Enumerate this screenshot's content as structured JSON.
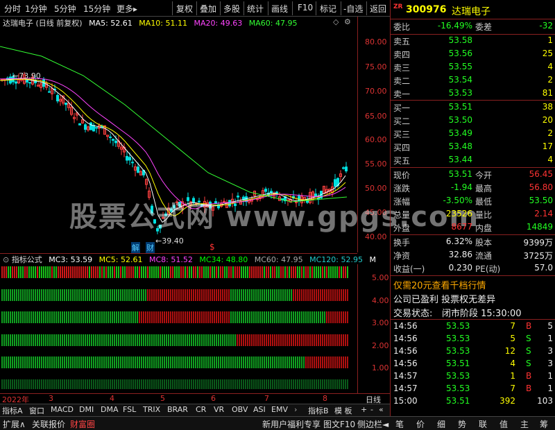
{
  "toolbar": {
    "items": [
      "分时",
      "1分钟",
      "5分钟",
      "15分钟",
      "更多",
      "复权",
      "叠加",
      "多股",
      "统计",
      "画线",
      "F10",
      "标记",
      "-自选",
      "返回"
    ]
  },
  "chart": {
    "title": "达瑞电子 (日线 前复权)",
    "ma": [
      {
        "label": "MA5: 52.61",
        "color": "#ffffff"
      },
      {
        "label": "MA10: 51.11",
        "color": "#ffff00"
      },
      {
        "label": "MA20: 49.63",
        "color": "#ff44ff"
      },
      {
        "label": "MA60: 47.95",
        "color": "#33ff33"
      }
    ],
    "y_ticks": [
      "80.00",
      "75.00",
      "70.00",
      "65.00",
      "60.00",
      "55.00",
      "50.00",
      "45.00",
      "40.00"
    ],
    "high_annot": "73.90",
    "low_annot": "39.40",
    "jie": "解",
    "cai": "财",
    "dollar": "$"
  },
  "indicator": {
    "title": "指标公式",
    "labels": [
      {
        "t": "MC3: 53.59",
        "c": "#ffffff"
      },
      {
        "t": "MC5: 52.61",
        "c": "#ffff00"
      },
      {
        "t": "MC8: 51.52",
        "c": "#ff44ff"
      },
      {
        "t": "MC34: 48.80",
        "c": "#00ff00"
      },
      {
        "t": "MC60: 47.95",
        "c": "#aaaaaa"
      },
      {
        "t": "MC120: 52.95",
        "c": "#22cccc"
      },
      {
        "t": "M",
        "c": "#ffffff"
      }
    ],
    "y_ticks": [
      "5.00",
      "4.00",
      "3.00",
      "2.00",
      "1.00"
    ]
  },
  "dates": [
    "2022年",
    "3",
    "4",
    "5",
    "6",
    "7",
    "8"
  ],
  "date_right": "日线",
  "ind_tabs": [
    "指标A",
    "窗口",
    "MACD",
    "DMI",
    "DMA",
    "FSL",
    "TRIX",
    "BRAR",
    "CR",
    "VR",
    "OBV",
    "ASI",
    "EMV",
    "指标B",
    "模 板"
  ],
  "bottom_left": [
    "扩展∧",
    "关联报价",
    "财富圈"
  ],
  "bottom_right": [
    "新用户福利专享",
    "图文F10",
    "侧边栏"
  ],
  "quote": {
    "zr": "ZR",
    "code": "300976",
    "name": "达瑞电子",
    "weibi_label": "委比",
    "weibi": "-16.49%",
    "weicha_label": "委差",
    "weicha": "-32",
    "sells": [
      {
        "l": "卖五",
        "p": "53.58",
        "v": "1"
      },
      {
        "l": "卖四",
        "p": "53.56",
        "v": "25"
      },
      {
        "l": "卖三",
        "p": "53.55",
        "v": "4"
      },
      {
        "l": "卖二",
        "p": "53.54",
        "v": "2"
      },
      {
        "l": "卖一",
        "p": "53.53",
        "v": "81"
      }
    ],
    "buys": [
      {
        "l": "买一",
        "p": "53.51",
        "v": "38"
      },
      {
        "l": "买二",
        "p": "53.50",
        "v": "20"
      },
      {
        "l": "买三",
        "p": "53.49",
        "v": "2"
      },
      {
        "l": "买四",
        "p": "53.48",
        "v": "17"
      },
      {
        "l": "买五",
        "p": "53.44",
        "v": "4"
      }
    ],
    "stats": [
      {
        "l1": "现价",
        "v1": "53.51",
        "c1": "green",
        "l2": "今开",
        "v2": "56.45",
        "c2": "red"
      },
      {
        "l1": "涨跌",
        "v1": "-1.94",
        "c1": "green",
        "l2": "最高",
        "v2": "56.80",
        "c2": "red"
      },
      {
        "l1": "涨幅",
        "v1": "-3.50%",
        "c1": "green",
        "l2": "最低",
        "v2": "53.50",
        "c2": "green"
      },
      {
        "l1": "总量",
        "v1": "23526",
        "c1": "yellow",
        "l2": "量比",
        "v2": "2.14",
        "c2": "red"
      },
      {
        "l1": "外盘",
        "v1": "8677",
        "c1": "red",
        "l2": "内盘",
        "v2": "14849",
        "c2": "green"
      }
    ],
    "stats2": [
      {
        "l1": "换手",
        "v1": "6.32%",
        "l2": "股本",
        "v2": "9399万"
      },
      {
        "l1": "净资",
        "v1": "32.86",
        "l2": "流通",
        "v2": "3725万"
      },
      {
        "l1": "收益(一)",
        "v1": "0.230",
        "l2": "PE(动)",
        "v2": "57.0"
      }
    ],
    "promo": "仅需20元查看千档行情",
    "company": "公司已盈利 投票权无差异",
    "status_label": "交易状态:",
    "status": "闭市阶段 15:30:00",
    "ticks": [
      {
        "t": "14:56",
        "p": "53.53",
        "v": "7",
        "d": "B",
        "n": "5",
        "pc": "green",
        "dc": "red"
      },
      {
        "t": "14:56",
        "p": "53.53",
        "v": "5",
        "d": "S",
        "n": "1",
        "pc": "green",
        "dc": "green"
      },
      {
        "t": "14:56",
        "p": "53.53",
        "v": "12",
        "d": "S",
        "n": "3",
        "pc": "green",
        "dc": "green"
      },
      {
        "t": "14:56",
        "p": "53.51",
        "v": "4",
        "d": "S",
        "n": "3",
        "pc": "green",
        "dc": "green"
      },
      {
        "t": "14:57",
        "p": "53.53",
        "v": "1",
        "d": "B",
        "n": "1",
        "pc": "green",
        "dc": "red"
      },
      {
        "t": "14:57",
        "p": "53.53",
        "v": "7",
        "d": "B",
        "n": "1",
        "pc": "green",
        "dc": "red"
      },
      {
        "t": "15:00",
        "p": "53.51",
        "v": "392",
        "d": "",
        "n": "103",
        "pc": "green",
        "dc": "red"
      }
    ]
  },
  "nav": [
    "笔",
    "价",
    "细",
    "势",
    "联",
    "值",
    "主",
    "筹"
  ],
  "watermark": "股票公式网  www.gpgs.com"
}
